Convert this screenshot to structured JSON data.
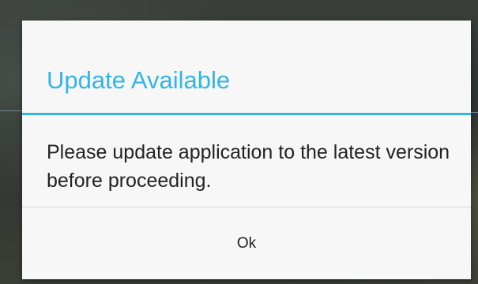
{
  "dialog": {
    "title": "Update Available",
    "message": "Please update application to the latest version before proceeding.",
    "ok_label": "Ok"
  },
  "colors": {
    "accent": "#33b5e5",
    "dialog_background": "#f7f7f7",
    "text": "#222222"
  }
}
